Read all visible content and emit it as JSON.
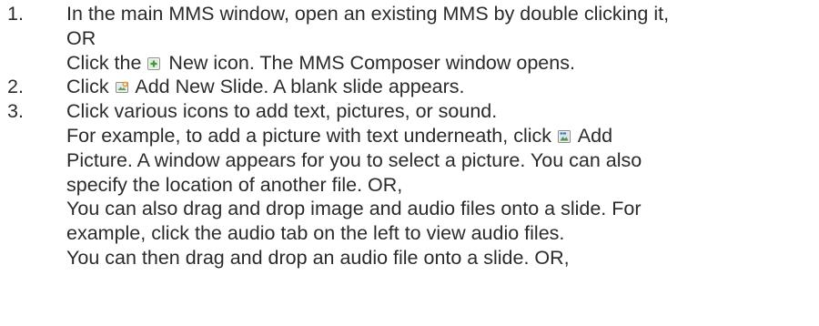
{
  "steps": [
    {
      "number": "1.",
      "line1": "In the main MMS window, open an existing MMS by double clicking it,",
      "line2": "OR",
      "line3_before": "Click the",
      "line3_icon": "new-icon",
      "line3_after": "New icon. The MMS Composer window opens."
    },
    {
      "number": "2.",
      "before": "Click",
      "icon": "add-slide-icon",
      "after": "Add New Slide. A blank slide appears."
    },
    {
      "number": "3.",
      "line1": "Click various icons to add text, pictures, or sound.",
      "line2_before": "For example, to add a picture with text underneath, click",
      "line2_icon": "add-picture-icon",
      "line2_after": "Add",
      "line3": "Picture. A window appears for you to select a picture. You can also",
      "line4": "specify the location of another file. OR,",
      "line5": "You can also drag and drop image and audio files onto a slide. For",
      "line6": "example, click the audio tab on the left to view audio files.",
      "line7": "You can then drag and drop an audio file onto a slide.  OR,"
    }
  ]
}
